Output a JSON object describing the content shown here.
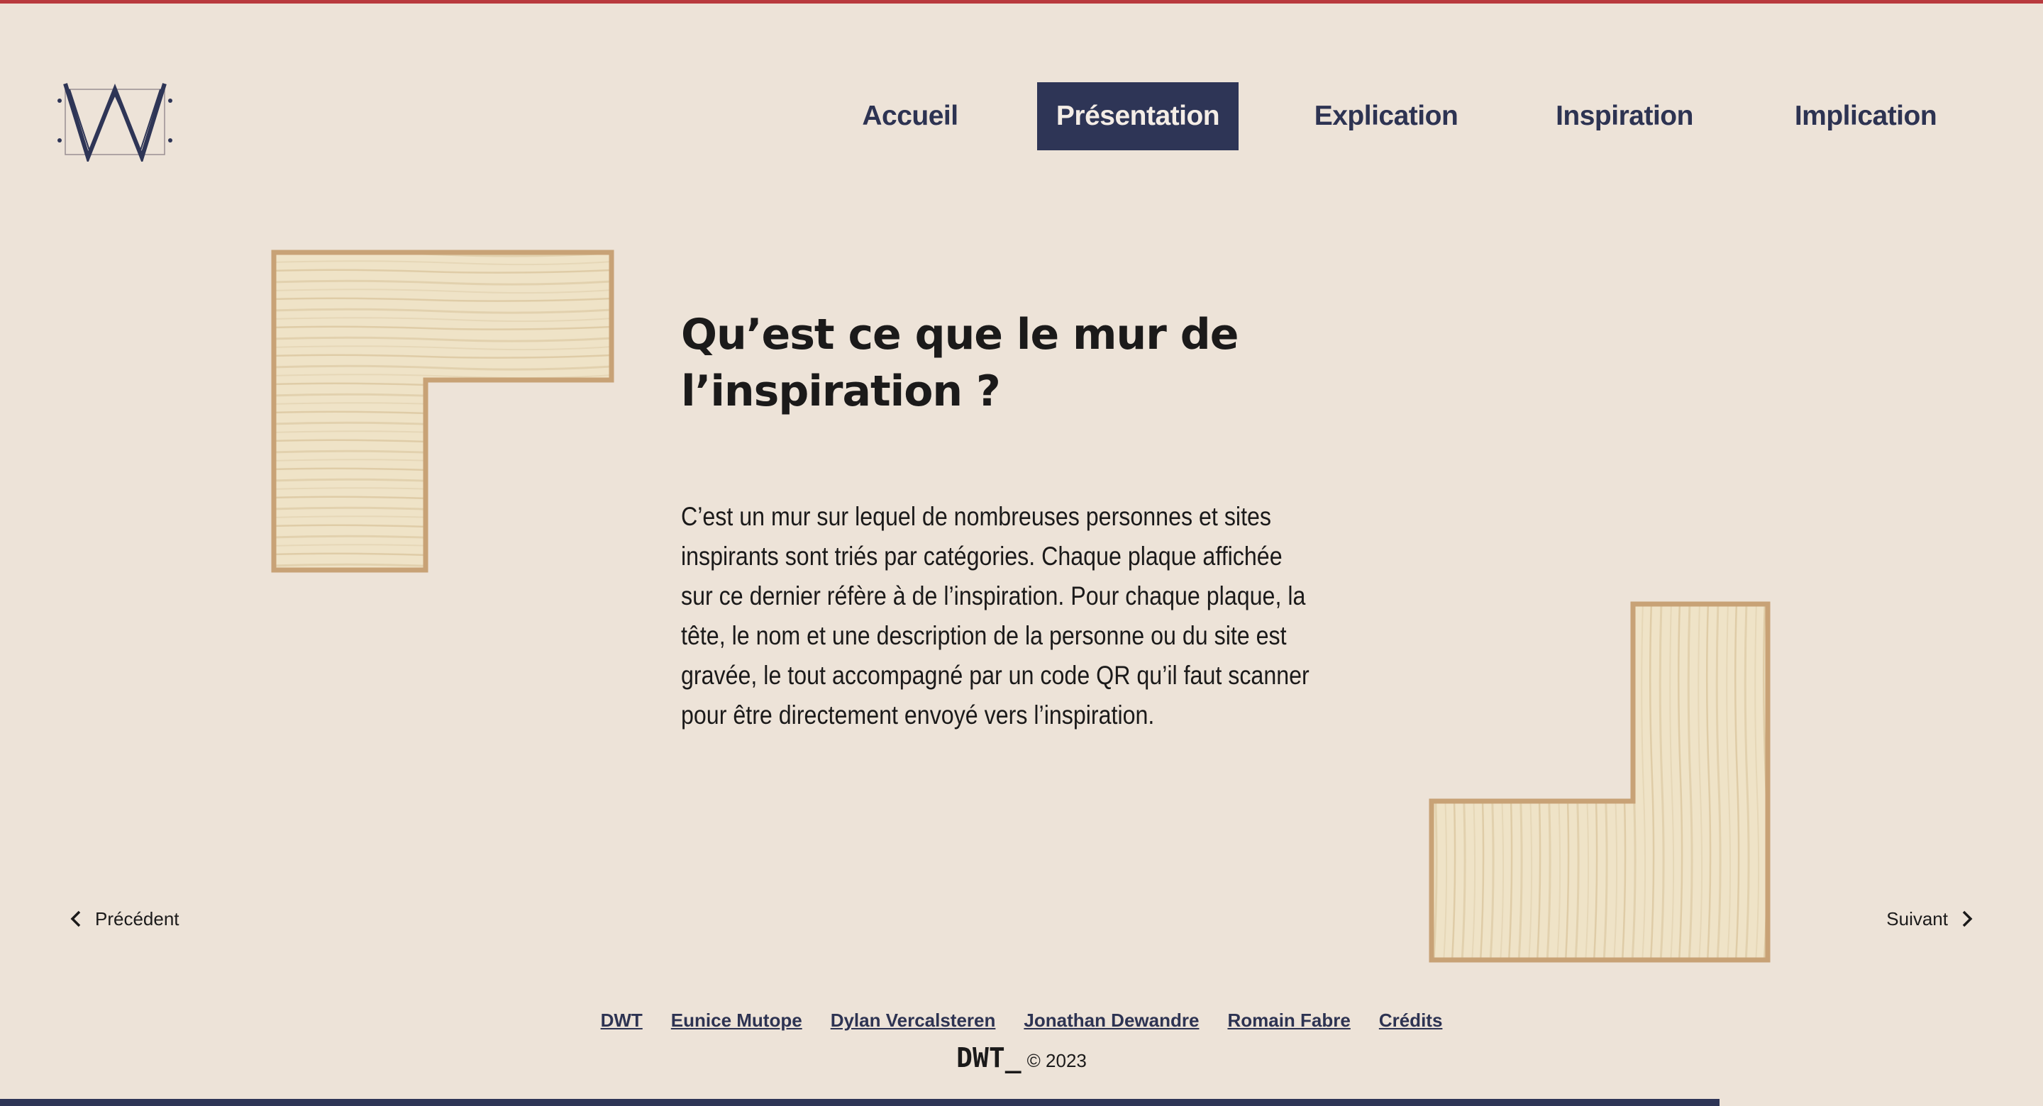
{
  "nav": {
    "items": [
      {
        "label": "Accueil",
        "active": false
      },
      {
        "label": "Présentation",
        "active": true
      },
      {
        "label": "Explication",
        "active": false
      },
      {
        "label": "Inspiration",
        "active": false
      },
      {
        "label": "Implication",
        "active": false
      }
    ]
  },
  "main": {
    "title_line1": "Qu’est ce que le mur de",
    "title_line2": "l’inspiration ?",
    "paragraph": "C’est un mur sur lequel de nombreuses personnes et sites inspirants sont triés par catégories. Chaque plaque affichée sur ce dernier réfère à de l’inspiration. Pour chaque plaque, la tête, le nom et une description de la personne ou du site est gravée, le tout accompagné par un code QR qu’il faut scanner pour être directement envoyé vers l’inspiration."
  },
  "pager": {
    "prev_label": "Précédent",
    "next_label": "Suivant"
  },
  "footer": {
    "links": [
      "DWT",
      "Eunice Mutope",
      "Dylan Vercalsteren",
      "Jonathan Dewandre",
      "Romain Fabre",
      "Crédits"
    ],
    "brand": "DWT_",
    "copyright": "© 2023"
  },
  "colors": {
    "background": "#ede3d8",
    "accent_navy": "#2e3556",
    "top_line": "#b93a3e",
    "wood_border": "#c8a276",
    "wood_fill": "#eee2c6"
  },
  "icons": {
    "logo": "w-logo",
    "prev": "chevron-left-icon",
    "next": "chevron-right-icon"
  }
}
